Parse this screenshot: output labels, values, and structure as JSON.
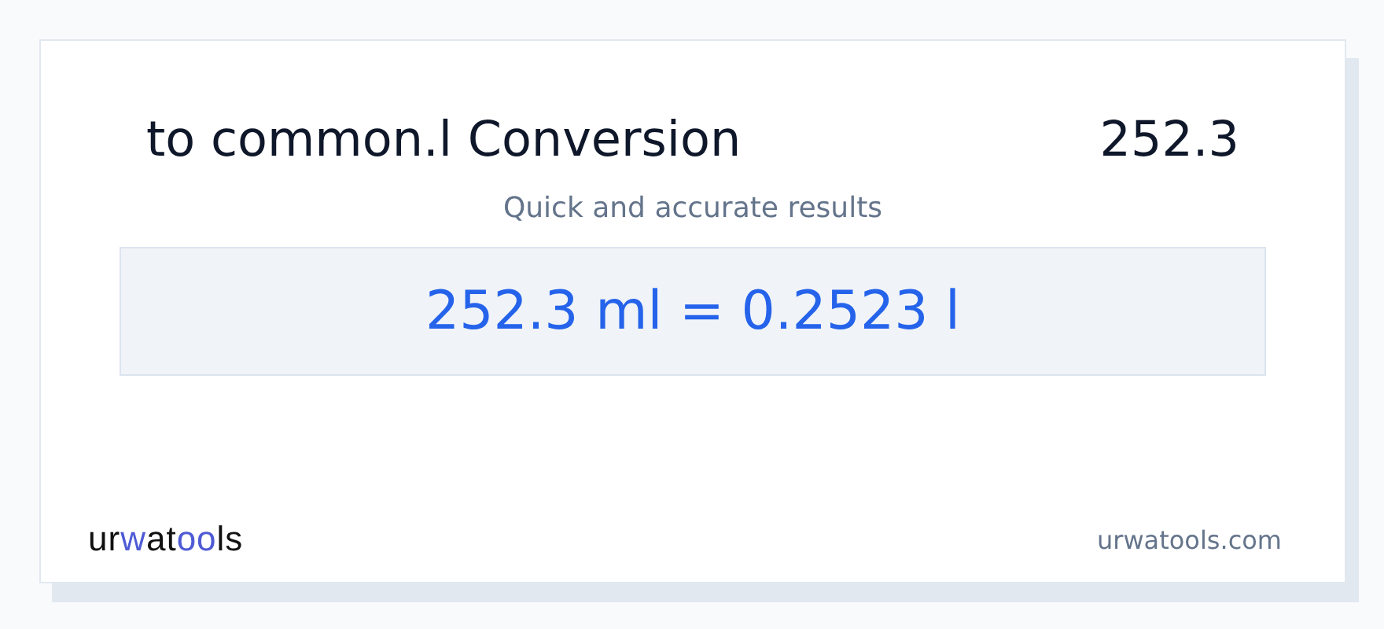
{
  "header": {
    "title": "to common.l Conversion",
    "value": "252.3"
  },
  "subtitle": "Quick and accurate results",
  "result": "252.3 ml = 0.2523 l",
  "footer": {
    "logo": [
      {
        "text": "ur",
        "accent": false
      },
      {
        "text": "w",
        "accent": true
      },
      {
        "text": "at",
        "accent": false
      },
      {
        "text": "oo",
        "accent": true
      },
      {
        "text": "ls",
        "accent": false
      }
    ],
    "site": "urwatools.com"
  }
}
